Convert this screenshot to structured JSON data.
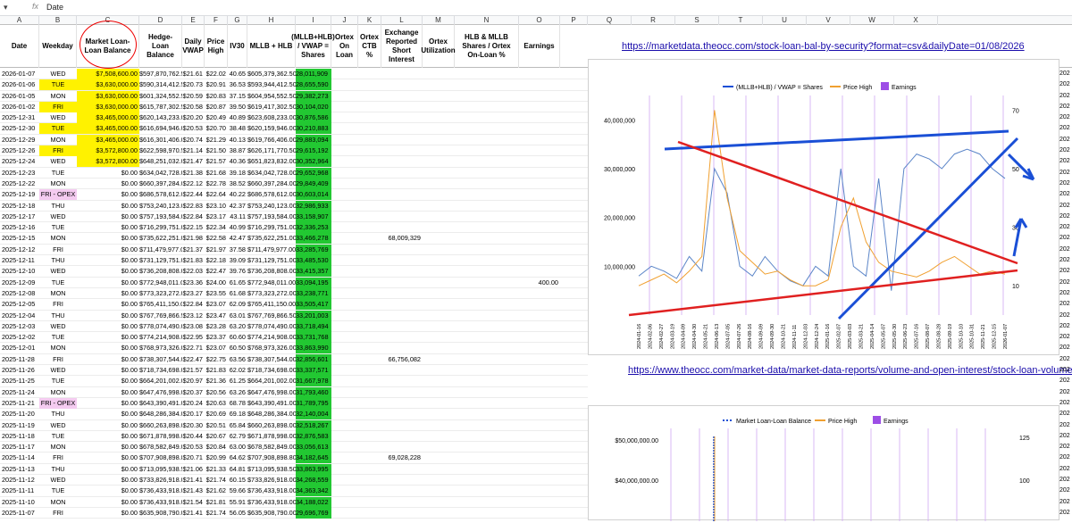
{
  "formula_bar": {
    "cell_ref": "▾",
    "fx": "fx",
    "value": "Date"
  },
  "columns": [
    "A",
    "B",
    "C",
    "D",
    "E",
    "F",
    "G",
    "H",
    "I",
    "J",
    "K",
    "L",
    "M",
    "N",
    "O",
    "P",
    "Q",
    "R",
    "S",
    "T",
    "U",
    "V",
    "W",
    "X"
  ],
  "headers": {
    "date": "Date",
    "weekday": "Weekday",
    "market_loan": "Market Loan-Loan Balance",
    "hedge_loan": "Hedge-Loan Balance",
    "daily_vwap": "Daily VWAP",
    "price_high": "Price High",
    "iv30": "IV30",
    "mllb_hlb": "MLLB + HLB",
    "mllb_vwap": "(MLLB+HLB) / VWAP = Shares",
    "ortex_on_loan": "Ortex On Loan",
    "ortex_ctb": "Ortex CTB %",
    "exchange_si": "Exchange Reported Short Interest",
    "ortex_util": "Ortex Utilization",
    "hlb_mllb_shares": "HLB & MLLB Shares / Ortex On-Loan %",
    "earnings": "Earnings"
  },
  "links": {
    "top": "https://marketdata.theocc.com/stock-loan-bal-by-security?format=csv&dailyDate=01/08/2026",
    "bottom": "https://www.theocc.com/market-data/market-data-reports/volume-and-open-interest/stock-loan-volume"
  },
  "rows": [
    [
      "2026-01-07",
      "WED",
      "$7,508,600.00",
      "$597,870,762.50",
      "$21.61",
      "$22.02",
      "40.65",
      "$605,379,362.50",
      "28,011,909",
      "",
      "",
      ""
    ],
    [
      "2026-01-06",
      "TUE",
      "$3,630,000.00",
      "$590,314,412.50",
      "$20.73",
      "$20.91",
      "36.53",
      "$593,944,412.50",
      "28,655,590",
      "",
      "",
      ""
    ],
    [
      "2026-01-05",
      "MON",
      "$3,630,000.00",
      "$601,324,552.50",
      "$20.59",
      "$20.83",
      "37.15",
      "$604,954,552.50",
      "29,382,273",
      "",
      "",
      ""
    ],
    [
      "2026-01-02",
      "FRI",
      "$3,630,000.00",
      "$615,787,302.50",
      "$20.58",
      "$20.87",
      "39.50",
      "$619,417,302.50",
      "30,104,020",
      "",
      "",
      ""
    ],
    [
      "2025-12-31",
      "WED",
      "$3,465,000.00",
      "$620,143,233.00",
      "$20.20",
      "$20.49",
      "40.89",
      "$623,608,233.00",
      "30,876,586",
      "",
      "",
      ""
    ],
    [
      "2025-12-30",
      "TUE",
      "$3,465,000.00",
      "$616,694,946.00",
      "$20.53",
      "$20.70",
      "38.48",
      "$620,159,946.00",
      "30,210,883",
      "",
      "",
      ""
    ],
    [
      "2025-12-29",
      "MON",
      "$3,465,000.00",
      "$616,301,406.00",
      "$20.74",
      "$21.29",
      "40.13",
      "$619,766,406.00",
      "29,883,094",
      "",
      "",
      ""
    ],
    [
      "2025-12-26",
      "FRI",
      "$3,572,800.00",
      "$622,598,970.50",
      "$21.14",
      "$21.50",
      "38.87",
      "$626,171,770.50",
      "29,615,192",
      "",
      "",
      ""
    ],
    [
      "2025-12-24",
      "WED",
      "$3,572,800.00",
      "$648,251,032.00",
      "$21.47",
      "$21.57",
      "40.36",
      "$651,823,832.00",
      "30,352,964",
      "",
      "",
      ""
    ],
    [
      "2025-12-23",
      "TUE",
      "$0.00",
      "$634,042,728.00",
      "$21.38",
      "$21.68",
      "39.18",
      "$634,042,728.00",
      "29,652,968",
      "",
      "",
      ""
    ],
    [
      "2025-12-22",
      "MON",
      "$0.00",
      "$660,397,284.00",
      "$22.12",
      "$22.78",
      "38.52",
      "$660,397,284.00",
      "29,849,409",
      "",
      "",
      ""
    ],
    [
      "2025-12-19",
      "FRI - OPEX",
      "$0.00",
      "$686,578,612.00",
      "$22.44",
      "$22.64",
      "40.22",
      "$686,578,612.00",
      "30,603,014",
      "",
      "",
      ""
    ],
    [
      "2025-12-18",
      "THU",
      "$0.00",
      "$753,240,123.00",
      "$22.83",
      "$23.10",
      "42.37",
      "$753,240,123.00",
      "32,986,933",
      "",
      "",
      ""
    ],
    [
      "2025-12-17",
      "WED",
      "$0.00",
      "$757,193,584.00",
      "$22.84",
      "$23.17",
      "43.11",
      "$757,193,584.00",
      "33,158,907",
      "",
      "",
      ""
    ],
    [
      "2025-12-16",
      "TUE",
      "$0.00",
      "$716,299,751.00",
      "$22.15",
      "$22.34",
      "40.99",
      "$716,299,751.00",
      "32,336,253",
      "",
      "",
      ""
    ],
    [
      "2025-12-15",
      "MON",
      "$0.00",
      "$735,622,251.00",
      "$21.98",
      "$22.58",
      "42.47",
      "$735,622,251.00",
      "33,466,278",
      "",
      "68,009,329",
      ""
    ],
    [
      "2025-12-12",
      "FRI",
      "$0.00",
      "$711,479,977.00",
      "$21.37",
      "$21.97",
      "37.58",
      "$711,479,977.00",
      "33,285,769",
      "",
      "",
      ""
    ],
    [
      "2025-12-11",
      "THU",
      "$0.00",
      "$731,129,751.00",
      "$21.83",
      "$22.18",
      "39.09",
      "$731,129,751.00",
      "33,485,530",
      "",
      "",
      ""
    ],
    [
      "2025-12-10",
      "WED",
      "$0.00",
      "$736,208,808.00",
      "$22.03",
      "$22.47",
      "39.76",
      "$736,208,808.00",
      "33,415,357",
      "",
      "",
      ""
    ],
    [
      "2025-12-09",
      "TUE",
      "$0.00",
      "$772,948,011.00",
      "$23.36",
      "$24.00",
      "61.65",
      "$772,948,011.00",
      "33,094,195",
      "",
      "",
      "400.00"
    ],
    [
      "2025-12-08",
      "MON",
      "$0.00",
      "$773,323,272.00",
      "$23.27",
      "$23.55",
      "61.68",
      "$773,323,272.00",
      "33,238,771",
      "",
      "",
      ""
    ],
    [
      "2025-12-05",
      "FRI",
      "$0.00",
      "$765,411,150.00",
      "$22.84",
      "$23.07",
      "62.09",
      "$765,411,150.00",
      "33,505,417",
      "",
      "",
      ""
    ],
    [
      "2025-12-04",
      "THU",
      "$0.00",
      "$767,769,866.50",
      "$23.12",
      "$23.47",
      "63.01",
      "$767,769,866.50",
      "33,201,003",
      "",
      "",
      ""
    ],
    [
      "2025-12-03",
      "WED",
      "$0.00",
      "$778,074,490.00",
      "$23.08",
      "$23.28",
      "63.20",
      "$778,074,490.00",
      "33,718,494",
      "",
      "",
      ""
    ],
    [
      "2025-12-02",
      "TUE",
      "$0.00",
      "$774,214,908.00",
      "$22.95",
      "$23.37",
      "60.60",
      "$774,214,908.00",
      "33,731,768",
      "",
      "",
      ""
    ],
    [
      "2025-12-01",
      "MON",
      "$0.00",
      "$768,973,326.00",
      "$22.71",
      "$23.07",
      "60.50",
      "$768,973,326.00",
      "33,863,990",
      "",
      "",
      ""
    ],
    [
      "2025-11-28",
      "FRI",
      "$0.00",
      "$738,307,544.00",
      "$22.47",
      "$22.75",
      "63.56",
      "$738,307,544.00",
      "32,856,601",
      "",
      "66,756,082",
      ""
    ],
    [
      "2025-11-26",
      "WED",
      "$0.00",
      "$718,734,698.00",
      "$21.57",
      "$21.83",
      "62.02",
      "$718,734,698.00",
      "33,337,571",
      "",
      "",
      ""
    ],
    [
      "2025-11-25",
      "TUE",
      "$0.00",
      "$664,201,002.00",
      "$20.97",
      "$21.36",
      "61.25",
      "$664,201,002.00",
      "31,667,978",
      "",
      "",
      ""
    ],
    [
      "2025-11-24",
      "MON",
      "$0.00",
      "$647,476,998.00",
      "$20.37",
      "$20.56",
      "63.26",
      "$647,476,998.00",
      "31,793,460",
      "",
      "",
      ""
    ],
    [
      "2025-11-21",
      "FRI - OPEX",
      "$0.00",
      "$643,390,491.00",
      "$20.24",
      "$20.63",
      "68.78",
      "$643,390,491.00",
      "31,789,795",
      "",
      "",
      ""
    ],
    [
      "2025-11-20",
      "THU",
      "$0.00",
      "$648,286,384.00",
      "$20.17",
      "$20.69",
      "69.18",
      "$648,286,384.00",
      "32,140,004",
      "",
      "",
      ""
    ],
    [
      "2025-11-19",
      "WED",
      "$0.00",
      "$660,263,898.00",
      "$20.30",
      "$20.51",
      "65.84",
      "$660,263,898.00",
      "32,518,267",
      "",
      "",
      ""
    ],
    [
      "2025-11-18",
      "TUE",
      "$0.00",
      "$671,878,998.00",
      "$20.44",
      "$20.67",
      "62.79",
      "$671,878,998.00",
      "32,876,583",
      "",
      "",
      ""
    ],
    [
      "2025-11-17",
      "MON",
      "$0.00",
      "$678,582,849.00",
      "$20.53",
      "$20.84",
      "63.00",
      "$678,582,849.00",
      "33,056,613",
      "",
      "",
      ""
    ],
    [
      "2025-11-14",
      "FRI",
      "$0.00",
      "$707,908,898.80",
      "$20.71",
      "$20.99",
      "64.62",
      "$707,908,898.80",
      "34,182,645",
      "",
      "69,028,228",
      ""
    ],
    [
      "2025-11-13",
      "THU",
      "$0.00",
      "$713,095,938.50",
      "$21.06",
      "$21.33",
      "64.81",
      "$713,095,938.50",
      "33,863,995",
      "",
      "",
      ""
    ],
    [
      "2025-11-12",
      "WED",
      "$0.00",
      "$733,826,918.00",
      "$21.41",
      "$21.74",
      "60.15",
      "$733,826,918.00",
      "34,268,559",
      "",
      "",
      ""
    ],
    [
      "2025-11-11",
      "TUE",
      "$0.00",
      "$736,433,918.00",
      "$21.43",
      "$21.62",
      "59.66",
      "$736,433,918.00",
      "34,363,342",
      "",
      "",
      ""
    ],
    [
      "2025-11-10",
      "MON",
      "$0.00",
      "$736,433,918.00",
      "$21.54",
      "$21.81",
      "55.91",
      "$736,433,918.00",
      "34,188,022",
      "",
      "",
      ""
    ],
    [
      "2025-11-07",
      "FRI",
      "$0.00",
      "$635,908,790.00",
      "$21.41",
      "$21.74",
      "56.05",
      "$635,908,790.00",
      "29,696,769",
      "",
      "",
      ""
    ]
  ],
  "right_edge_values": [
    "202",
    "202",
    "202",
    "202",
    "202",
    "202",
    "202",
    "202",
    "202",
    "202",
    "202",
    "202",
    "202",
    "202",
    "202",
    "202",
    "202",
    "202",
    "202",
    "202",
    "202",
    "202",
    "202",
    "202",
    "202",
    "202",
    "202",
    "202",
    "202",
    "202",
    "202",
    "202",
    "202",
    "202",
    "202",
    "202",
    "202",
    "202",
    "202",
    "202",
    "202"
  ],
  "colors": {
    "green": "#22c832",
    "highlight": "#fff200",
    "opex": "#f4cbf0",
    "blue": "#1a4fd6",
    "red": "#e02020",
    "orange": "#f0a030",
    "purple": "#9d4ee6"
  },
  "chart_data": [
    {
      "type": "line",
      "series": [
        {
          "name": "(MLLB+HLB) / VWAP = Shares",
          "axis": "left",
          "values": [
            8000000,
            10000000,
            9000000,
            7500000,
            12000000,
            9000000,
            30000000,
            25000000,
            10000000,
            8000000,
            12000000,
            9000000,
            7000000,
            6000000,
            10000000,
            8000000,
            30000000,
            10000000,
            8000000,
            28000000,
            5000000,
            30000000,
            33000000,
            32000000,
            30000000,
            33000000,
            34000000,
            33000000,
            30000000,
            28000000
          ]
        },
        {
          "name": "Price High",
          "axis": "right",
          "values": [
            10,
            12,
            14,
            11,
            15,
            20,
            70,
            40,
            22,
            18,
            14,
            15,
            12,
            10,
            10,
            12,
            30,
            40,
            25,
            18,
            15,
            14,
            13,
            15,
            18,
            20,
            17,
            14,
            15,
            14
          ]
        },
        {
          "name": "Earnings",
          "axis": "right",
          "values": []
        }
      ],
      "left_axis": [
        "40,000,000",
        "30,000,000",
        "20,000,000",
        "10,000,000"
      ],
      "right_axis": [
        "70",
        "50",
        "30",
        "10"
      ],
      "x_labels": [
        "2024-01-16",
        "2024-02-06",
        "2024-02-27",
        "2024-03-19",
        "2024-04-09",
        "2024-04-30",
        "2024-05-21",
        "2024-06-13",
        "2024-07-05",
        "2024-07-26",
        "2024-08-16",
        "2024-09-09",
        "2024-09-30",
        "2024-10-21",
        "2024-11-11",
        "2024-12-03",
        "2024-12-24",
        "2025-01-16",
        "2025-02-07",
        "2025-03-03",
        "2025-03-21",
        "2025-04-14",
        "2025-05-07",
        "2025-05-30",
        "2025-06-23",
        "2025-07-16",
        "2025-08-07",
        "2025-08-28",
        "2025-09-19",
        "2025-10-10",
        "2025-10-31",
        "2025-11-21",
        "2025-12-15",
        "2026-01-07"
      ],
      "legend": "top"
    },
    {
      "type": "line",
      "series": [
        {
          "name": "Market Loan-Loan Balance",
          "axis": "left",
          "values": []
        },
        {
          "name": "Price High",
          "axis": "right",
          "values": []
        },
        {
          "name": "Earnings",
          "axis": "right",
          "values": []
        }
      ],
      "left_axis": [
        "$50,000,000.00",
        "$40,000,000.00"
      ],
      "right_axis": [
        "125",
        "100"
      ],
      "legend": "top"
    }
  ]
}
